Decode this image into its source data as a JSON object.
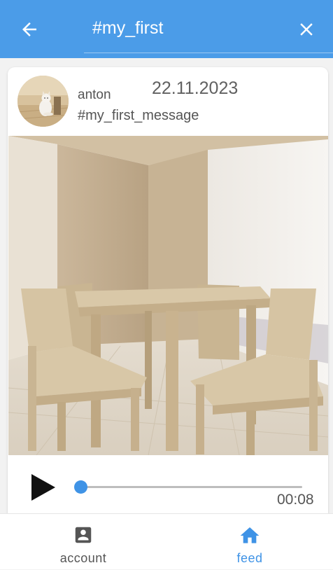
{
  "appbar": {
    "search_value": "#my_first",
    "color": "#4b9ce8",
    "back_icon": "arrow-left-icon",
    "close_icon": "close-icon"
  },
  "post": {
    "author": "anton",
    "date": "22.11.2023",
    "tag": "#my_first_message",
    "avatar_icon": "cat-photo",
    "image_subject": "wooden-table-and-chairs-photo"
  },
  "player": {
    "play_icon": "play-icon",
    "position_fraction": 0.0,
    "time": "00:08",
    "accent": "#3f93e6"
  },
  "nav": {
    "items": [
      {
        "label": "account",
        "icon": "account-box-icon",
        "active": false
      },
      {
        "label": "feed",
        "icon": "home-icon",
        "active": true
      }
    ],
    "active_color": "#3f93e6"
  }
}
